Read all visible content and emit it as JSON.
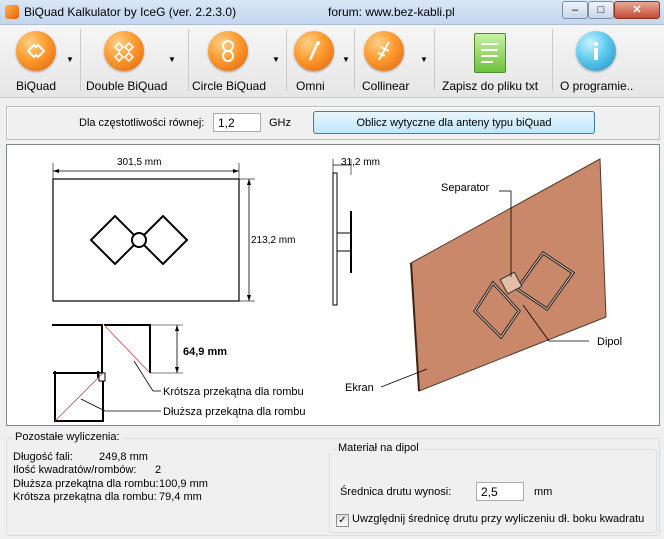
{
  "window": {
    "title": "BiQuad Kalkulator by IceG (ver. 2.2.3.0)",
    "forum": "forum: www.bez-kabli.pl"
  },
  "toolbar": {
    "items": [
      {
        "label": "BiQuad",
        "icon": "biquad-icon",
        "dropdown": true
      },
      {
        "label": "Double BiQuad",
        "icon": "double-biquad-icon",
        "dropdown": true
      },
      {
        "label": "Circle BiQuad",
        "icon": "circle-biquad-icon",
        "dropdown": true
      },
      {
        "label": "Omni",
        "icon": "omni-icon",
        "dropdown": true
      },
      {
        "label": "Collinear",
        "icon": "collinear-icon",
        "dropdown": true
      },
      {
        "label": "Zapisz do pliku txt",
        "icon": "save-txt-icon",
        "dropdown": false
      },
      {
        "label": "O programie..",
        "icon": "info-icon",
        "dropdown": false
      }
    ]
  },
  "frequency": {
    "label": "Dla częstotliwości równej:",
    "value": "1,2",
    "unit": "GHz",
    "button": "Oblicz wytyczne dla anteny typu biQuad"
  },
  "drawing": {
    "width_dim": "301,5 mm",
    "height_dim": "213,2 mm",
    "depth_dim": "31,2 mm",
    "side_dim": "64,9 mm",
    "short_diag_label": "Krótsza przekątna dla rombu",
    "long_diag_label": "Dłuższa przekątna dla rombu",
    "separator_label": "Separator",
    "dipol_label": "Dipol",
    "ekran_label": "Ekran"
  },
  "results": {
    "title": "Pozostałe wyliczenia:",
    "rows": [
      {
        "label": "Długość fali:",
        "value": "249,8 mm"
      },
      {
        "label": "Ilość kwadratów/rombów:",
        "value": "2"
      },
      {
        "label": "Dłuższa przekątna dla rombu:",
        "value": "100,9 mm"
      },
      {
        "label": "Krótsza przekątna dla rombu:",
        "value": "79,4 mm"
      }
    ]
  },
  "material": {
    "title": "Materiał na dipol",
    "wire_label": "Średnica drutu wynosi:",
    "wire_value": "2,5",
    "wire_unit": "mm",
    "checkbox_label": "Uwzględnij średnicę drutu przy wyliczeniu dł. boku kwadratu",
    "checkbox_checked": true
  }
}
